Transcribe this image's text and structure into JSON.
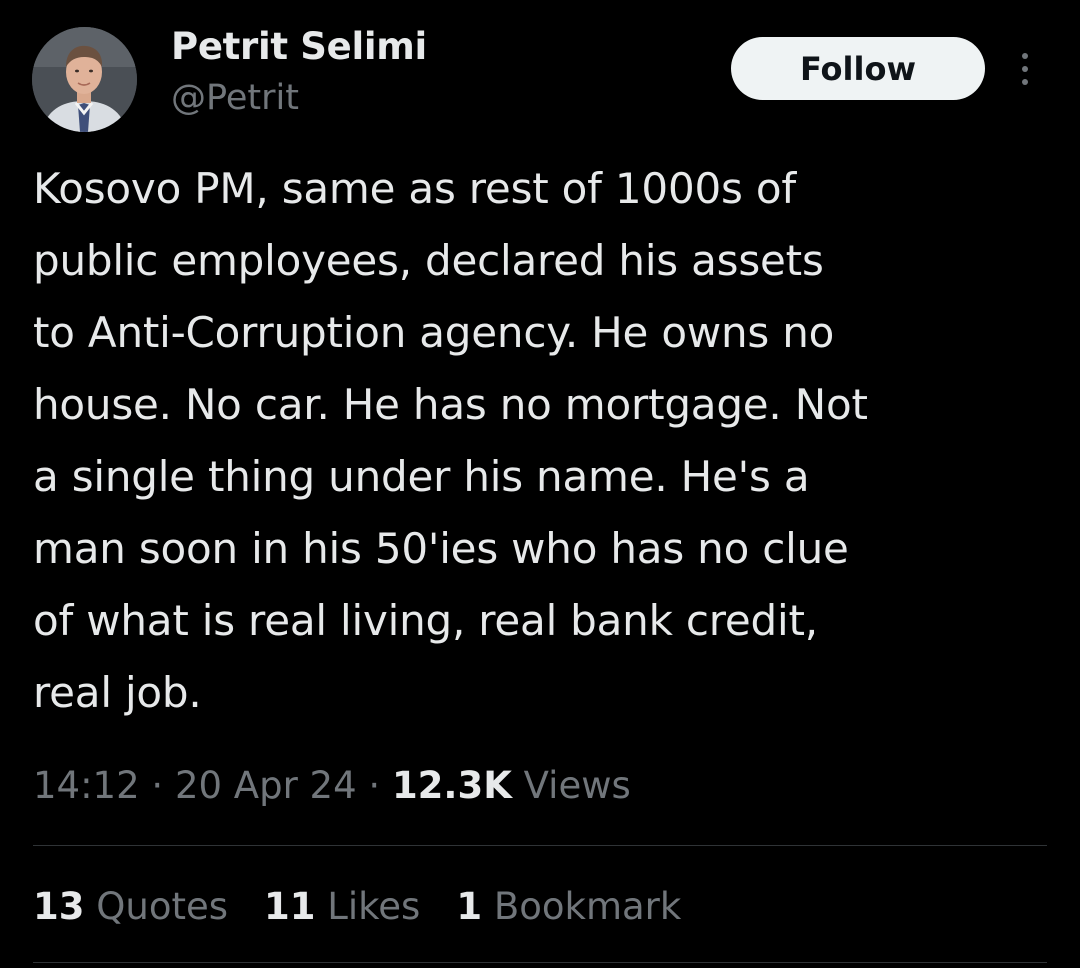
{
  "author": {
    "display_name": "Petrit Selimi",
    "handle": "@Petrit"
  },
  "follow_label": "Follow",
  "tweet": {
    "lines": [
      "Kosovo PM, same as rest of 1000s of",
      "public employees, declared his assets",
      "to Anti-Corruption agency. He owns no",
      "house. No car. He has no mortgage. Not",
      "a single thing under his name. He's a",
      "man soon in his 50'ies who has no clue",
      "of what is real living, real bank credit,",
      "real job."
    ]
  },
  "meta": {
    "time": "14:12",
    "separator": " · ",
    "date": "20 Apr 24",
    "views_count": "12.3K",
    "views_label": " Views"
  },
  "stats": {
    "quotes": {
      "count": "13",
      "label": " Quotes"
    },
    "likes": {
      "count": "11",
      "label": " Likes"
    },
    "bookmarks": {
      "count": "1",
      "label": " Bookmark"
    }
  },
  "colors": {
    "background": "#000000",
    "primary_text": "#e7e9ea",
    "secondary_text": "#71767b",
    "follow_button_bg": "#eff3f4",
    "divider": "#2f3336"
  }
}
